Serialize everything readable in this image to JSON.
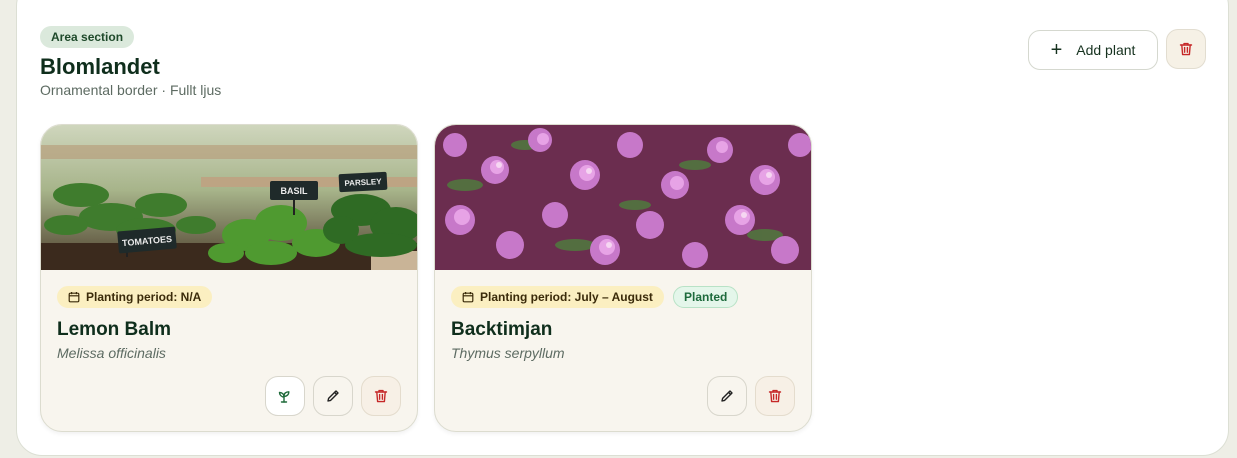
{
  "area": {
    "badge": "Area section",
    "title": "Blomlandet",
    "subtitle": "Ornamental border · Fullt ljus",
    "add_plant_label": "Add plant",
    "add_icon": "plus-icon",
    "delete_icon": "trash-icon"
  },
  "plants": [
    {
      "name": "Lemon Balm",
      "scientific": "Melissa officinalis",
      "planting_period": "Planting period: N/A",
      "photo_labels": [
        "TOMATOES",
        "BASIL",
        "PARSLEY"
      ],
      "actions": [
        "sprout-icon",
        "pencil-icon",
        "trash-icon"
      ]
    },
    {
      "name": "Backtimjan",
      "scientific": "Thymus serpyllum",
      "planting_period": "Planting period: July – August",
      "status": "Planted",
      "actions": [
        "pencil-icon",
        "trash-icon"
      ]
    }
  ],
  "colors": {
    "brand_dark": "#0f2e1c",
    "danger": "#c62828",
    "badge_green": "#dbe9dc",
    "period_pill": "#fbefc1",
    "status_pill": "#e4f6ea"
  }
}
